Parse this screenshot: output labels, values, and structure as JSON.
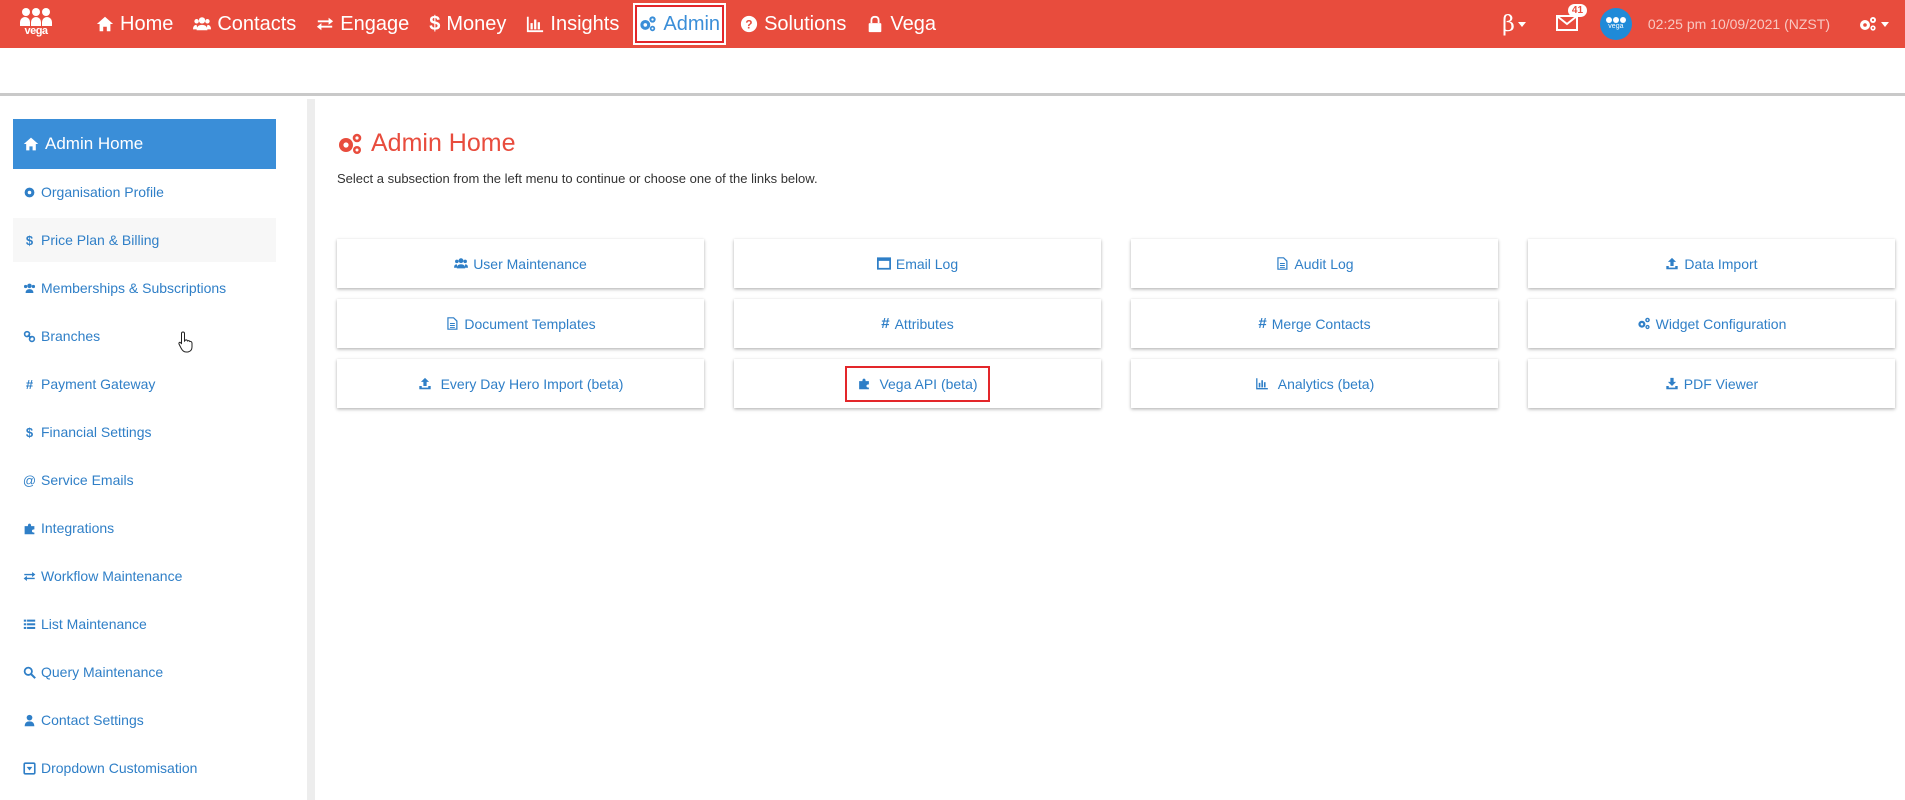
{
  "brand": {
    "logo_text": "vega"
  },
  "nav": {
    "items": [
      {
        "label": "Home",
        "icon": "home-icon",
        "active": false
      },
      {
        "label": "Contacts",
        "icon": "users-icon",
        "active": false
      },
      {
        "label": "Engage",
        "icon": "exchange-icon",
        "active": false
      },
      {
        "label": "Money",
        "icon": "dollar-icon",
        "active": false
      },
      {
        "label": "Insights",
        "icon": "bar-chart-icon",
        "active": false
      },
      {
        "label": "Admin",
        "icon": "cogs-icon",
        "active": true
      },
      {
        "label": "Solutions",
        "icon": "question-circle-icon",
        "active": false
      },
      {
        "label": "Vega",
        "icon": "lock-icon",
        "active": false
      }
    ]
  },
  "header_right": {
    "beta_symbol": "β",
    "mail_count": "41",
    "avatar_text": "vega",
    "datetime": "02:25 pm 10/09/2021 (NZST)"
  },
  "sidebar": {
    "home_label": "Admin Home",
    "items": [
      {
        "label": "Organisation Profile",
        "icon": "cog-icon"
      },
      {
        "label": "Price Plan & Billing",
        "icon": "dollar-icon"
      },
      {
        "label": "Memberships & Subscriptions",
        "icon": "users-icon"
      },
      {
        "label": "Branches",
        "icon": "link-icon"
      },
      {
        "label": "Payment Gateway",
        "icon": "hashtag-icon"
      },
      {
        "label": "Financial Settings",
        "icon": "dollar-icon"
      },
      {
        "label": "Service Emails",
        "icon": "at-icon"
      },
      {
        "label": "Integrations",
        "icon": "puzzle-icon"
      },
      {
        "label": "Workflow Maintenance",
        "icon": "exchange-icon"
      },
      {
        "label": "List Maintenance",
        "icon": "list-icon"
      },
      {
        "label": "Query Maintenance",
        "icon": "search-icon"
      },
      {
        "label": "Contact Settings",
        "icon": "user-icon"
      },
      {
        "label": "Dropdown Customisation",
        "icon": "caret-square-icon"
      }
    ]
  },
  "main": {
    "title": "Admin Home",
    "subtitle": "Select a subsection from the left menu to continue or choose one of the links below.",
    "cards": [
      {
        "label": "User Maintenance",
        "icon": "users-icon"
      },
      {
        "label": "Email Log",
        "icon": "window-icon"
      },
      {
        "label": "Audit Log",
        "icon": "file-icon"
      },
      {
        "label": "Data Import",
        "icon": "upload-icon"
      },
      {
        "label": "Document Templates",
        "icon": "file-icon"
      },
      {
        "label": "Attributes",
        "icon": "hashtag-icon"
      },
      {
        "label": "Merge Contacts",
        "icon": "hashtag-icon"
      },
      {
        "label": "Widget Configuration",
        "icon": "cogs-icon"
      },
      {
        "label": "Every Day Hero Import (beta)",
        "icon": "upload-icon"
      },
      {
        "label": "Vega API (beta)",
        "icon": "puzzle-icon",
        "highlighted": true
      },
      {
        "label": "Analytics (beta)",
        "icon": "bar-chart-icon"
      },
      {
        "label": "PDF Viewer",
        "icon": "download-icon"
      }
    ]
  },
  "colors": {
    "primary": "#e84c3d",
    "link": "#2f7fc7",
    "active_blue": "#3a8ed8",
    "highlight": "#e3262a"
  }
}
